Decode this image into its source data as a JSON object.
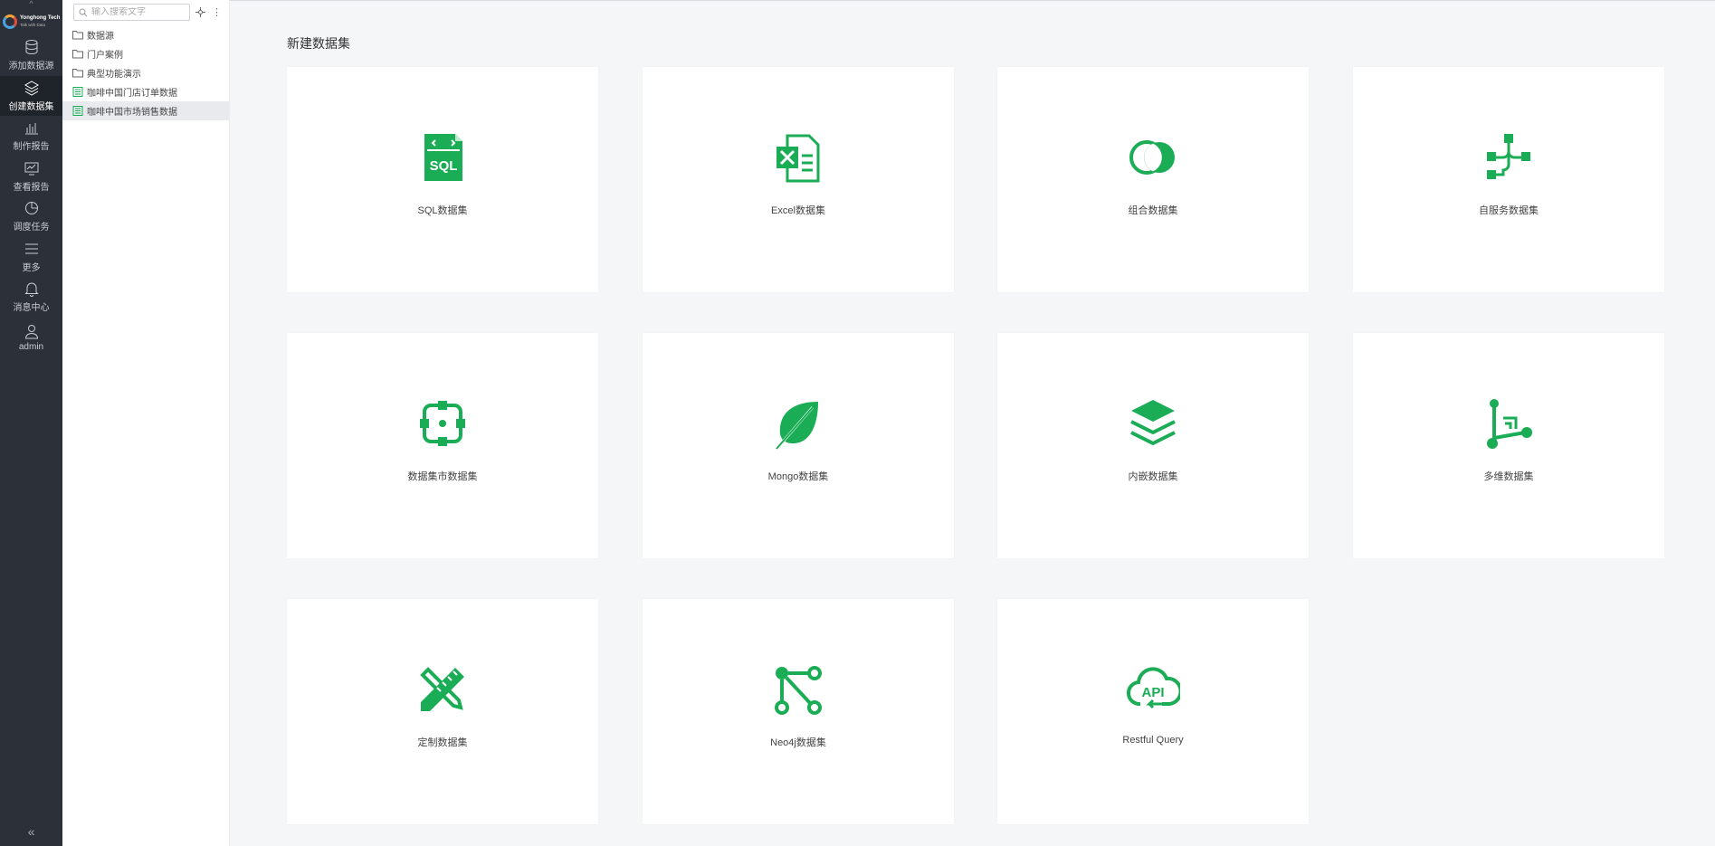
{
  "nav": {
    "brand": "Yonghong Tech",
    "brand_sub": "Talk with Data",
    "items": [
      {
        "label": "添加数据源",
        "icon": "database-icon"
      },
      {
        "label": "创建数据集",
        "icon": "layers-icon",
        "active": true
      },
      {
        "label": "制作报告",
        "icon": "bar-chart-icon"
      },
      {
        "label": "查看报告",
        "icon": "monitor-chart-icon"
      },
      {
        "label": "调度任务",
        "icon": "clock-pie-icon"
      },
      {
        "label": "更多",
        "icon": "menu-icon"
      },
      {
        "label": "消息中心",
        "icon": "bell-icon"
      },
      {
        "label": "admin",
        "icon": "user-icon"
      }
    ]
  },
  "tree": {
    "search_placeholder": "输入搜索文字",
    "items": [
      {
        "label": "数据源",
        "type": "folder"
      },
      {
        "label": "门户案例",
        "type": "folder"
      },
      {
        "label": "典型功能演示",
        "type": "folder"
      },
      {
        "label": "咖啡中国门店订单数据",
        "type": "dataset"
      },
      {
        "label": "咖啡中国市场销售数据",
        "type": "dataset",
        "selected": true
      }
    ]
  },
  "main": {
    "title": "新建数据集",
    "cards": [
      {
        "label": "SQL数据集",
        "icon": "sql-file-icon"
      },
      {
        "label": "Excel数据集",
        "icon": "excel-icon"
      },
      {
        "label": "组合数据集",
        "icon": "venn-circles-icon"
      },
      {
        "label": "自服务数据集",
        "icon": "flow-nodes-icon"
      },
      {
        "label": "数据集市数据集",
        "icon": "target-frame-icon"
      },
      {
        "label": "Mongo数据集",
        "icon": "leaf-icon"
      },
      {
        "label": "内嵌数据集",
        "icon": "stack-layers-icon"
      },
      {
        "label": "多维数据集",
        "icon": "cube-axis-icon"
      },
      {
        "label": "定制数据集",
        "icon": "pencil-ruler-icon"
      },
      {
        "label": "Neo4j数据集",
        "icon": "graph-nodes-icon"
      },
      {
        "label": "Restful Query",
        "icon": "cloud-api-icon"
      }
    ]
  },
  "colors": {
    "accent": "#1aad55",
    "nav_bg": "#2c3038",
    "page_bg": "#f5f6f7"
  }
}
